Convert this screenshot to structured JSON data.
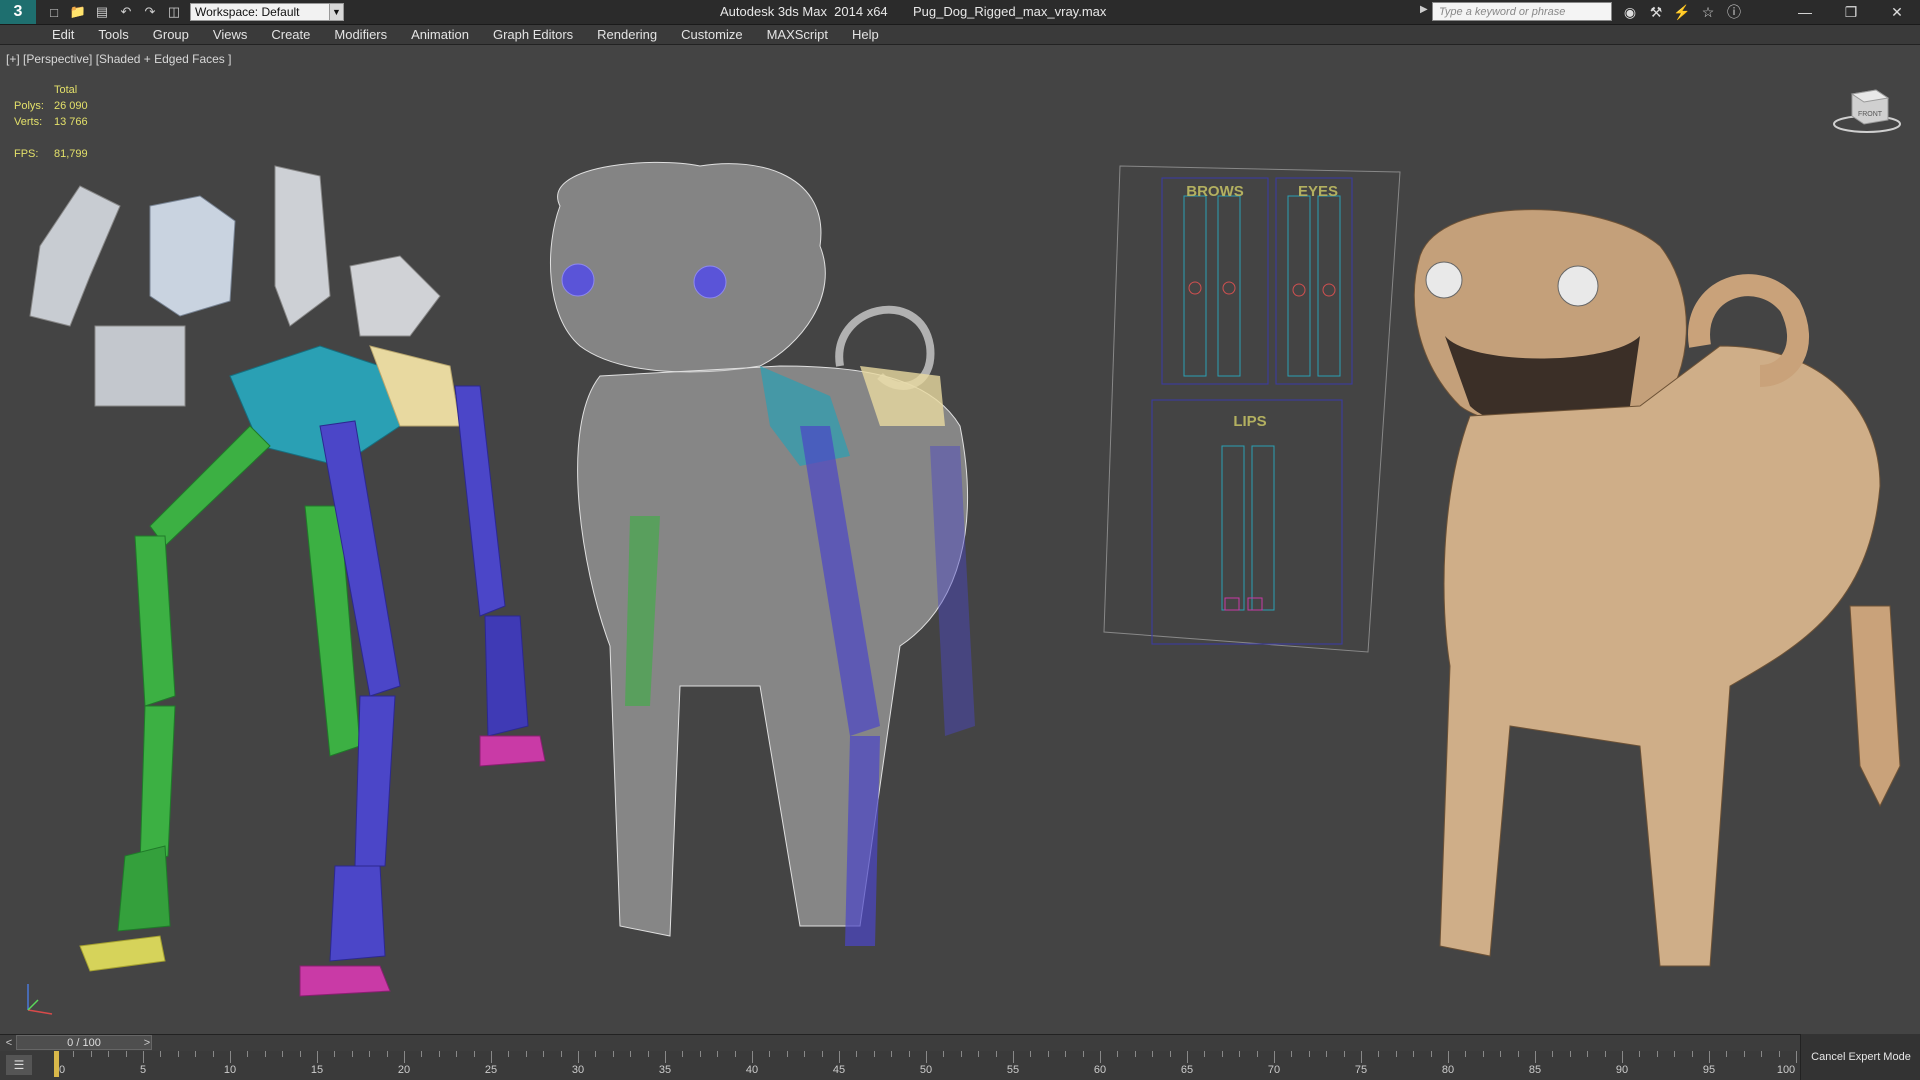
{
  "titlebar": {
    "logo_label": "3",
    "workspace_label": "Workspace: Default",
    "title_app": "Autodesk 3ds Max  2014 x64",
    "title_file": "Pug_Dog_Rigged_max_vray.max",
    "search_placeholder": "Type a keyword or phrase",
    "quick_access_icons": [
      "new-file-icon",
      "open-folder-icon",
      "save-icon",
      "undo-icon",
      "redo-icon",
      "project-folder-icon"
    ],
    "search_tool_icons": [
      "binoculars-icon",
      "subscription-icon",
      "communication-center-icon",
      "favorites-star-icon",
      "help-icon"
    ]
  },
  "menubar": {
    "items": [
      "Edit",
      "Tools",
      "Group",
      "Views",
      "Create",
      "Modifiers",
      "Animation",
      "Graph Editors",
      "Rendering",
      "Customize",
      "MAXScript",
      "Help"
    ]
  },
  "viewport": {
    "label": "[+] [Perspective] [Shaded + Edged Faces ]",
    "stats": {
      "header": "Total",
      "polys_label": "Polys:",
      "polys_value": "26 090",
      "verts_label": "Verts:",
      "verts_value": "13 766",
      "fps_label": "FPS:",
      "fps_value": "81,799"
    },
    "viewcube_label": "FRONT",
    "facial_controls": {
      "brows_label": "BROWS",
      "eyes_label": "EYES",
      "lips_label": "LIPS"
    }
  },
  "timeline": {
    "slider_label": "0 / 100",
    "tick_labels": [
      "0",
      "5",
      "10",
      "15",
      "20",
      "25",
      "30",
      "35",
      "40",
      "45",
      "50",
      "55",
      "60",
      "65",
      "70",
      "75",
      "80",
      "85",
      "90",
      "95",
      "100"
    ],
    "current_frame": 0,
    "total_frames": 100
  },
  "status": {
    "expert_mode_label": "Cancel Expert Mode"
  },
  "colors": {
    "viewport_bg": "#444444",
    "stats_text": "#e3e06a",
    "bone_green": "#3cb043",
    "bone_blue": "#4b46c8",
    "bone_cyan": "#2ea0b0",
    "bone_cream": "#e8d9a0",
    "pug_fur": "#c9a27a",
    "control_panel_blue": "#3a3aa8",
    "control_yellow": "#c9c96a"
  }
}
